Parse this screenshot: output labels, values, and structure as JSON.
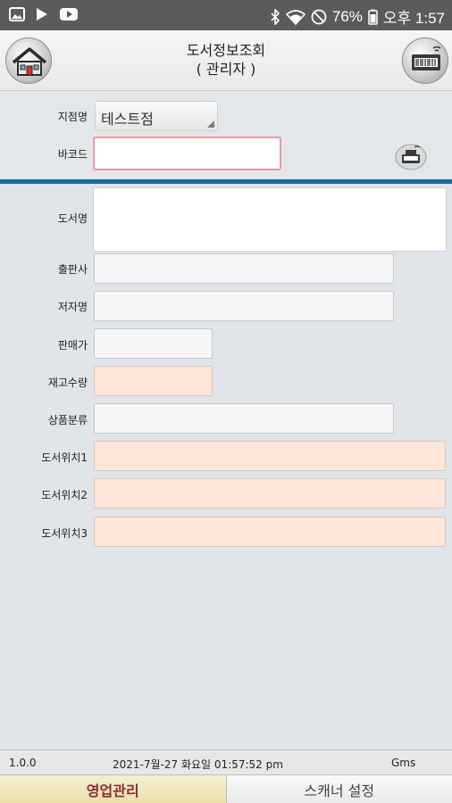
{
  "status_bar": {
    "battery": "76%",
    "time": "오후 1:57",
    "icons": [
      "gallery-icon",
      "play-store-icon",
      "youtube-icon",
      "bluetooth-icon",
      "wifi-icon",
      "dnd-icon",
      "battery-icon"
    ]
  },
  "header": {
    "title_line1": "도서정보조회",
    "title_line2": "( 관리자 )"
  },
  "form": {
    "branch_label": "지점명",
    "branch_value": "테스트점",
    "barcode_label": "바코드",
    "barcode_value": "",
    "barcode_placeholder": ""
  },
  "fields": {
    "title_label": "도서명",
    "publisher_label": "출판사",
    "author_label": "저자명",
    "price_label": "판매가",
    "stock_label": "재고수량",
    "category_label": "상품분류",
    "location1_label": "도서위치1",
    "location2_label": "도서위치2",
    "location3_label": "도서위치3"
  },
  "footer": {
    "version": "1.0.0",
    "datetime": "2021-7월-27 화요일 01:57:52 pm",
    "company": "Gms"
  },
  "tabs": [
    {
      "label": "영업관리",
      "active": true
    },
    {
      "label": "스캐너 설정",
      "active": false
    }
  ],
  "colors": {
    "accent_divider": "#1b6aa3",
    "barcode_border": "#e59aa6",
    "peach_field": "#fbe6d9",
    "active_tab_text": "#8a2f2f"
  }
}
